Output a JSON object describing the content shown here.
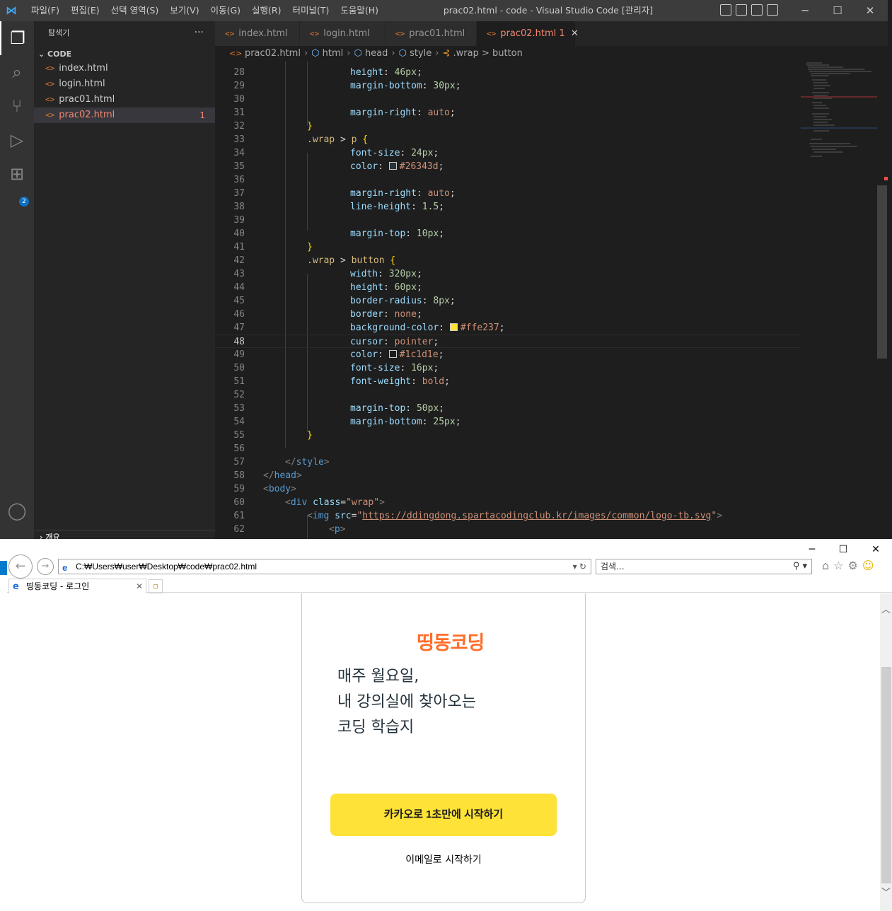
{
  "vscode": {
    "menu": [
      "파일(F)",
      "편집(E)",
      "선택 영역(S)",
      "보기(V)",
      "이동(G)",
      "실행(R)",
      "터미널(T)",
      "도움말(H)"
    ],
    "window_title": "prac02.html - code - Visual Studio Code [관리자]",
    "sidebar": {
      "title": "탐색기",
      "section": "CODE",
      "files": [
        {
          "name": "index.html"
        },
        {
          "name": "login.html"
        },
        {
          "name": "prac01.html"
        },
        {
          "name": "prac02.html",
          "badge": "1"
        }
      ],
      "outline": "개요"
    },
    "tabs": [
      {
        "label": "index.html"
      },
      {
        "label": "login.html"
      },
      {
        "label": "prac01.html"
      },
      {
        "label": "prac02.html",
        "badge": "1"
      }
    ],
    "breadcrumb": [
      "prac02.html",
      "html",
      "head",
      "style",
      ".wrap > button"
    ],
    "extensions_badge": "2",
    "current_line": 48
  },
  "code_lines": [
    {
      "n": 28,
      "segs": [
        [
          "prop",
          "height"
        ],
        [
          "p",
          ": "
        ],
        [
          "num",
          "46px"
        ],
        [
          "p",
          ";"
        ]
      ],
      "i": 4
    },
    {
      "n": 29,
      "segs": [
        [
          "prop",
          "margin-bottom"
        ],
        [
          "p",
          ": "
        ],
        [
          "num",
          "30px"
        ],
        [
          "p",
          ";"
        ]
      ],
      "i": 4
    },
    {
      "n": 30,
      "segs": [],
      "i": 4
    },
    {
      "n": 31,
      "segs": [
        [
          "prop",
          "margin-right"
        ],
        [
          "p",
          ": "
        ],
        [
          "val",
          "auto"
        ],
        [
          "p",
          ";"
        ]
      ],
      "i": 4
    },
    {
      "n": 32,
      "segs": [
        [
          "br",
          "}"
        ]
      ],
      "i": 2
    },
    {
      "n": 33,
      "segs": [
        [
          "sel",
          ".wrap"
        ],
        [
          "p",
          " > "
        ],
        [
          "sel",
          "p"
        ],
        [
          "p",
          " "
        ],
        [
          "br",
          "{"
        ]
      ],
      "i": 2
    },
    {
      "n": 34,
      "segs": [
        [
          "prop",
          "font-size"
        ],
        [
          "p",
          ": "
        ],
        [
          "num",
          "24px"
        ],
        [
          "p",
          ";"
        ]
      ],
      "i": 4
    },
    {
      "n": 35,
      "segs": [
        [
          "prop",
          "color"
        ],
        [
          "p",
          ": "
        ],
        [
          "sw",
          "#26343d"
        ],
        [
          "val",
          "#26343d"
        ],
        [
          "p",
          ";"
        ]
      ],
      "i": 4
    },
    {
      "n": 36,
      "segs": [],
      "i": 4
    },
    {
      "n": 37,
      "segs": [
        [
          "prop",
          "margin-right"
        ],
        [
          "p",
          ": "
        ],
        [
          "val",
          "auto"
        ],
        [
          "p",
          ";"
        ]
      ],
      "i": 4
    },
    {
      "n": 38,
      "segs": [
        [
          "prop",
          "line-height"
        ],
        [
          "p",
          ": "
        ],
        [
          "num",
          "1.5"
        ],
        [
          "p",
          ";"
        ]
      ],
      "i": 4
    },
    {
      "n": 39,
      "segs": [],
      "i": 4
    },
    {
      "n": 40,
      "segs": [
        [
          "prop",
          "margin-top"
        ],
        [
          "p",
          ": "
        ],
        [
          "num",
          "10px"
        ],
        [
          "p",
          ";"
        ]
      ],
      "i": 4
    },
    {
      "n": 41,
      "segs": [
        [
          "br",
          "}"
        ]
      ],
      "i": 2
    },
    {
      "n": 42,
      "segs": [
        [
          "sel",
          ".wrap"
        ],
        [
          "p",
          " > "
        ],
        [
          "sel",
          "button"
        ],
        [
          "p",
          " "
        ],
        [
          "br",
          "{"
        ]
      ],
      "i": 2
    },
    {
      "n": 43,
      "segs": [
        [
          "prop",
          "width"
        ],
        [
          "p",
          ": "
        ],
        [
          "num",
          "320px"
        ],
        [
          "p",
          ";"
        ]
      ],
      "i": 4
    },
    {
      "n": 44,
      "segs": [
        [
          "prop",
          "height"
        ],
        [
          "p",
          ": "
        ],
        [
          "num",
          "60px"
        ],
        [
          "p",
          ";"
        ]
      ],
      "i": 4
    },
    {
      "n": 45,
      "segs": [
        [
          "prop",
          "border-radius"
        ],
        [
          "p",
          ": "
        ],
        [
          "num",
          "8px"
        ],
        [
          "p",
          ";"
        ]
      ],
      "i": 4
    },
    {
      "n": 46,
      "segs": [
        [
          "prop",
          "border"
        ],
        [
          "p",
          ": "
        ],
        [
          "val",
          "none"
        ],
        [
          "p",
          ";"
        ]
      ],
      "i": 4
    },
    {
      "n": 47,
      "segs": [
        [
          "prop",
          "background-color"
        ],
        [
          "p",
          ": "
        ],
        [
          "sw",
          "#ffe237"
        ],
        [
          "val",
          "#ffe237"
        ],
        [
          "p",
          ";"
        ]
      ],
      "i": 4
    },
    {
      "n": 48,
      "segs": [
        [
          "prop",
          "cursor"
        ],
        [
          "p",
          ": "
        ],
        [
          "val",
          "pointer"
        ],
        [
          "p",
          ";"
        ]
      ],
      "i": 4
    },
    {
      "n": 49,
      "segs": [
        [
          "prop",
          "color"
        ],
        [
          "p",
          ": "
        ],
        [
          "sw",
          "#1c1d1e"
        ],
        [
          "val",
          "#1c1d1e"
        ],
        [
          "p",
          ";"
        ]
      ],
      "i": 4
    },
    {
      "n": 50,
      "segs": [
        [
          "prop",
          "font-size"
        ],
        [
          "p",
          ": "
        ],
        [
          "num",
          "16px"
        ],
        [
          "p",
          ";"
        ]
      ],
      "i": 4
    },
    {
      "n": 51,
      "segs": [
        [
          "prop",
          "font-weight"
        ],
        [
          "p",
          ": "
        ],
        [
          "val",
          "bold"
        ],
        [
          "p",
          ";"
        ]
      ],
      "i": 4
    },
    {
      "n": 52,
      "segs": [],
      "i": 4
    },
    {
      "n": 53,
      "segs": [
        [
          "prop",
          "margin-top"
        ],
        [
          "p",
          ": "
        ],
        [
          "num",
          "50px"
        ],
        [
          "p",
          ";"
        ]
      ],
      "i": 4
    },
    {
      "n": 54,
      "segs": [
        [
          "prop",
          "margin-bottom"
        ],
        [
          "p",
          ": "
        ],
        [
          "num",
          "25px"
        ],
        [
          "p",
          ";"
        ]
      ],
      "i": 4
    },
    {
      "n": 55,
      "segs": [
        [
          "br",
          "}"
        ]
      ],
      "i": 2
    },
    {
      "n": 56,
      "segs": [],
      "i": 2
    },
    {
      "n": 57,
      "segs": [
        [
          "ang",
          "</"
        ],
        [
          "tag",
          "style"
        ],
        [
          "ang",
          ">"
        ]
      ],
      "i": 1
    },
    {
      "n": 58,
      "segs": [
        [
          "ang",
          "</"
        ],
        [
          "tag",
          "head"
        ],
        [
          "ang",
          ">"
        ]
      ],
      "i": 0
    },
    {
      "n": 59,
      "segs": [
        [
          "ang",
          "<"
        ],
        [
          "tag",
          "body"
        ],
        [
          "ang",
          ">"
        ]
      ],
      "i": 0
    },
    {
      "n": 60,
      "segs": [
        [
          "ang",
          "<"
        ],
        [
          "tag",
          "div"
        ],
        [
          "p",
          " "
        ],
        [
          "attr",
          "class"
        ],
        [
          "p",
          "="
        ],
        [
          "str",
          "\"wrap\""
        ],
        [
          "ang",
          ">"
        ]
      ],
      "i": 1
    },
    {
      "n": 61,
      "segs": [
        [
          "ang",
          "<"
        ],
        [
          "tag",
          "img"
        ],
        [
          "p",
          " "
        ],
        [
          "attr",
          "src"
        ],
        [
          "p",
          "="
        ],
        [
          "str",
          "\""
        ],
        [
          "lnk",
          "https://ddingdong.spartacodingclub.kr/images/common/logo-tb.svg"
        ],
        [
          "str",
          "\""
        ],
        [
          "ang",
          ">"
        ]
      ],
      "i": 2
    },
    {
      "n": 62,
      "segs": [
        [
          "ang",
          "<"
        ],
        [
          "tag",
          "p"
        ],
        [
          "ang",
          ">"
        ]
      ],
      "i": 3
    }
  ],
  "browser": {
    "address": "C:₩Users₩user₩Desktop₩code₩prac02.html",
    "search_placeholder": "검색...",
    "tab_title": "띵동코딩 - 로그인",
    "page": {
      "logo_text": "띵동코딩",
      "paragraph": [
        "매주 월요일,",
        "내 강의실에 찾아오는",
        "코딩 학습지"
      ],
      "kakao_button": "카카오로 1초만에 시작하기",
      "email_link": "이메일로 시작하기"
    }
  },
  "colors": {
    "accent": "#007acc",
    "kakao_yellow": "#ffe237",
    "logo_orange": "#ff6d2a",
    "text_dark": "#26343d",
    "error": "#f48771"
  }
}
